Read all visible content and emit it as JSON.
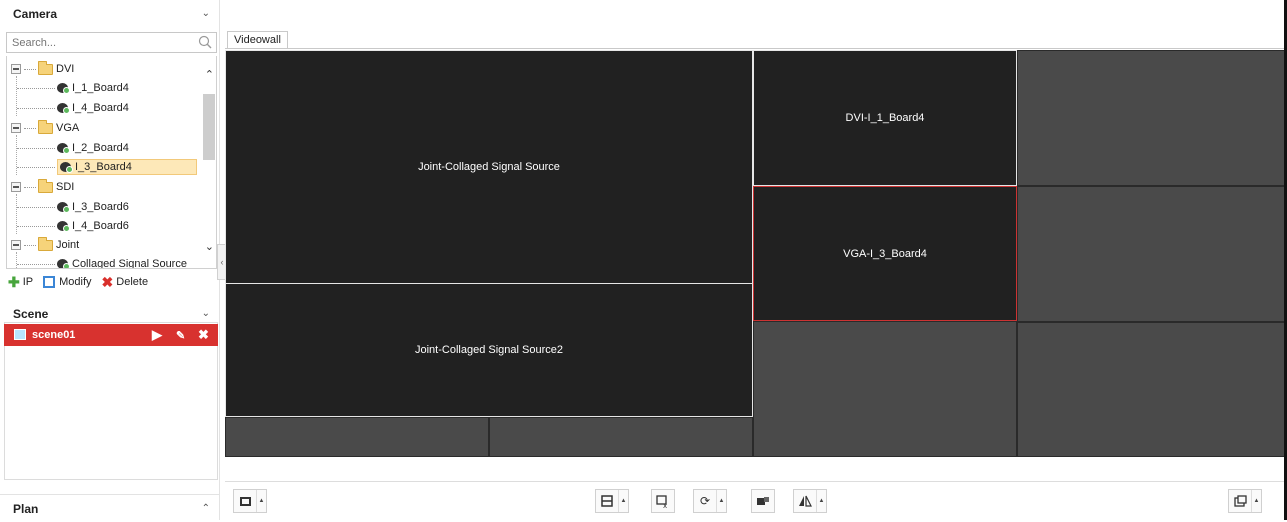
{
  "sidebar": {
    "camera_title": "Camera",
    "search_placeholder": "Search...",
    "tree": {
      "dvi": "DVI",
      "dvi_1": "I_1_Board4",
      "dvi_2": "I_4_Board4",
      "vga": "VGA",
      "vga_1": "I_2_Board4",
      "vga_2": "I_3_Board4",
      "sdi": "SDI",
      "sdi_1": "I_3_Board6",
      "sdi_2": "I_4_Board6",
      "joint": "Joint",
      "joint_1": "Collaged Signal Source"
    },
    "actions": {
      "ip": "IP",
      "modify": "Modify",
      "delete": "Delete"
    },
    "scene_title": "Scene",
    "scene_item": "scene01",
    "plan_title": "Plan"
  },
  "main": {
    "tab": "Videowall",
    "windows": {
      "joint1": "Joint-Collaged Signal Source",
      "joint2": "Joint-Collaged Signal Source2",
      "dvi": "DVI-I_1_Board4",
      "vga": "VGA-I_3_Board4"
    }
  },
  "colors": {
    "accent": "#d8322f",
    "window_bg": "#212121",
    "tile_bg": "#4a4a4a"
  }
}
